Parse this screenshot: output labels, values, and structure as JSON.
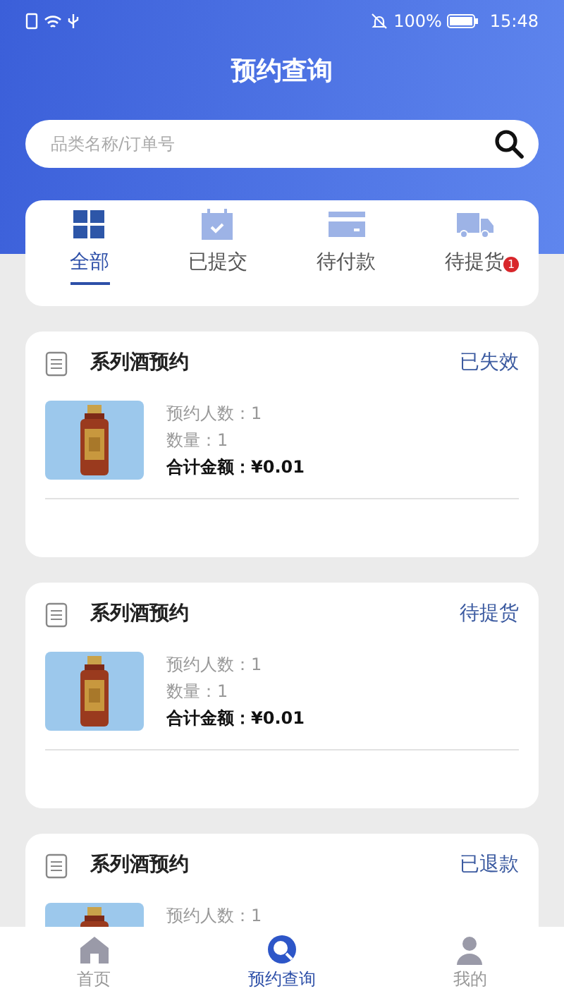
{
  "status_bar": {
    "battery_text": "100%",
    "time": "15:48"
  },
  "header": {
    "title": "预约查询"
  },
  "search": {
    "placeholder": "品类名称/订单号"
  },
  "tabs": [
    {
      "label": "全部",
      "kind": "grid",
      "selected": true
    },
    {
      "label": "已提交",
      "kind": "calendar",
      "selected": false
    },
    {
      "label": "待付款",
      "kind": "card",
      "selected": false
    },
    {
      "label": "待提货",
      "kind": "truck",
      "selected": false,
      "badge": "1"
    }
  ],
  "orders": [
    {
      "title": "系列酒预约",
      "status": "已失效",
      "persons": "预约人数：1",
      "quantity": "数量：1",
      "total_label": "合计金额：",
      "total": "¥0.01"
    },
    {
      "title": "系列酒预约",
      "status": "待提货",
      "persons": "预约人数：1",
      "quantity": "数量：1",
      "total_label": "合计金额：",
      "total": "¥0.01"
    },
    {
      "title": "系列酒预约",
      "status": "已退款",
      "persons": "预约人数：1"
    }
  ],
  "bottom_nav": [
    {
      "label": "首页",
      "kind": "home",
      "selected": false
    },
    {
      "label": "预约查询",
      "kind": "search",
      "selected": true
    },
    {
      "label": "我的",
      "kind": "person",
      "selected": false
    }
  ]
}
